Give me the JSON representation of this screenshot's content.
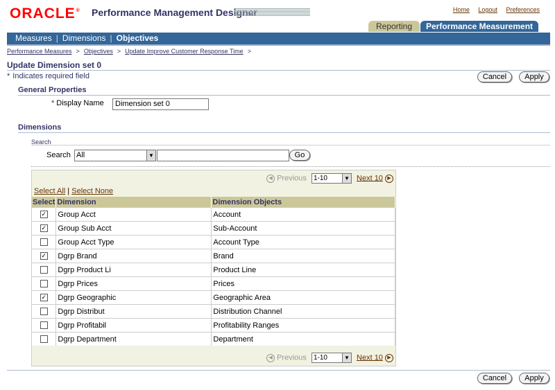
{
  "header": {
    "logo": "ORACLE",
    "app_title": "Performance Management Designer",
    "links": [
      "Home",
      "Logout",
      "Preferences"
    ]
  },
  "tabs": [
    {
      "label": "Reporting",
      "active": false
    },
    {
      "label": "Performance Measurement",
      "active": true
    }
  ],
  "subnav": [
    {
      "label": "Measures",
      "active": false
    },
    {
      "label": "Dimensions",
      "active": false
    },
    {
      "label": "Objectives",
      "active": true
    }
  ],
  "breadcrumb": [
    "Performance Measures",
    "Objectives",
    "Update Improve Customer Response Time"
  ],
  "page": {
    "title": "Update Dimension set 0",
    "required_note": "Indicates required field",
    "cancel_label": "Cancel",
    "apply_label": "Apply"
  },
  "general": {
    "title": "General Properties",
    "display_name_label": "Display Name",
    "display_name_value": "Dimension set 0"
  },
  "dimensions": {
    "title": "Dimensions",
    "search_title": "Search",
    "search_label": "Search",
    "search_select": "All",
    "search_text": "",
    "go_label": "Go",
    "prev_label": "Previous",
    "next_label": "Next 10",
    "range": "1-10",
    "select_all": "Select All",
    "select_none": "Select None",
    "columns": [
      "Select",
      "Dimension",
      "Dimension Objects"
    ],
    "rows": [
      {
        "selected": true,
        "dimension": "Group Acct",
        "objects": "Account"
      },
      {
        "selected": true,
        "dimension": "Group Sub Acct",
        "objects": "Sub-Account"
      },
      {
        "selected": false,
        "dimension": "Group Acct Type",
        "objects": "Account Type"
      },
      {
        "selected": true,
        "dimension": "Dgrp Brand",
        "objects": "Brand"
      },
      {
        "selected": false,
        "dimension": "Dgrp Product Li",
        "objects": "Product Line"
      },
      {
        "selected": false,
        "dimension": "Dgrp Prices",
        "objects": "Prices"
      },
      {
        "selected": true,
        "dimension": "Dgrp Geographic",
        "objects": "Geographic Area"
      },
      {
        "selected": false,
        "dimension": "Dgrp Distribut",
        "objects": "Distribution Channel"
      },
      {
        "selected": false,
        "dimension": "Dgrp Profitabil",
        "objects": "Profitability Ranges"
      },
      {
        "selected": false,
        "dimension": "Dgrp Department",
        "objects": "Department"
      }
    ]
  }
}
